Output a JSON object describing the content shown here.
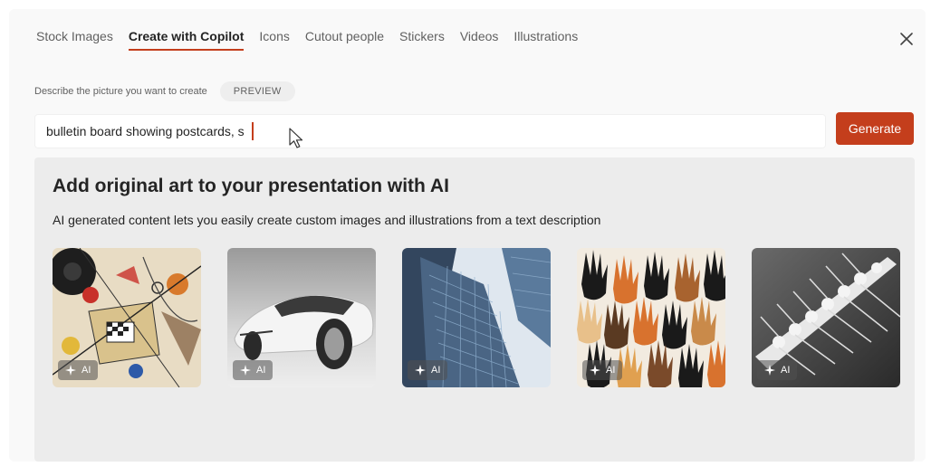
{
  "tabs": [
    {
      "label": "Stock Images",
      "active": false
    },
    {
      "label": "Create with Copilot",
      "active": true
    },
    {
      "label": "Icons",
      "active": false
    },
    {
      "label": "Cutout people",
      "active": false
    },
    {
      "label": "Stickers",
      "active": false
    },
    {
      "label": "Videos",
      "active": false
    },
    {
      "label": "Illustrations",
      "active": false
    }
  ],
  "close_icon": "close-icon",
  "describe": {
    "label": "Describe the picture you want to create",
    "badge": "PREVIEW"
  },
  "prompt": {
    "value": "bulletin board showing postcards, s"
  },
  "generate_label": "Generate",
  "panel": {
    "title": "Add original art to your presentation with AI",
    "subtitle": "AI generated content lets you easily create custom images and illustrations from a text description"
  },
  "gallery": [
    {
      "subject": "abstract geometric painting",
      "badge": "AI"
    },
    {
      "subject": "futuristic white concept car",
      "badge": "AI"
    },
    {
      "subject": "skyscrapers from below",
      "badge": "AI"
    },
    {
      "subject": "many raised hands",
      "badge": "AI"
    },
    {
      "subject": "rowing team in black and white",
      "badge": "AI"
    }
  ],
  "colors": {
    "accent": "#c43e1c",
    "panel": "#ececec",
    "text": "#242424"
  }
}
